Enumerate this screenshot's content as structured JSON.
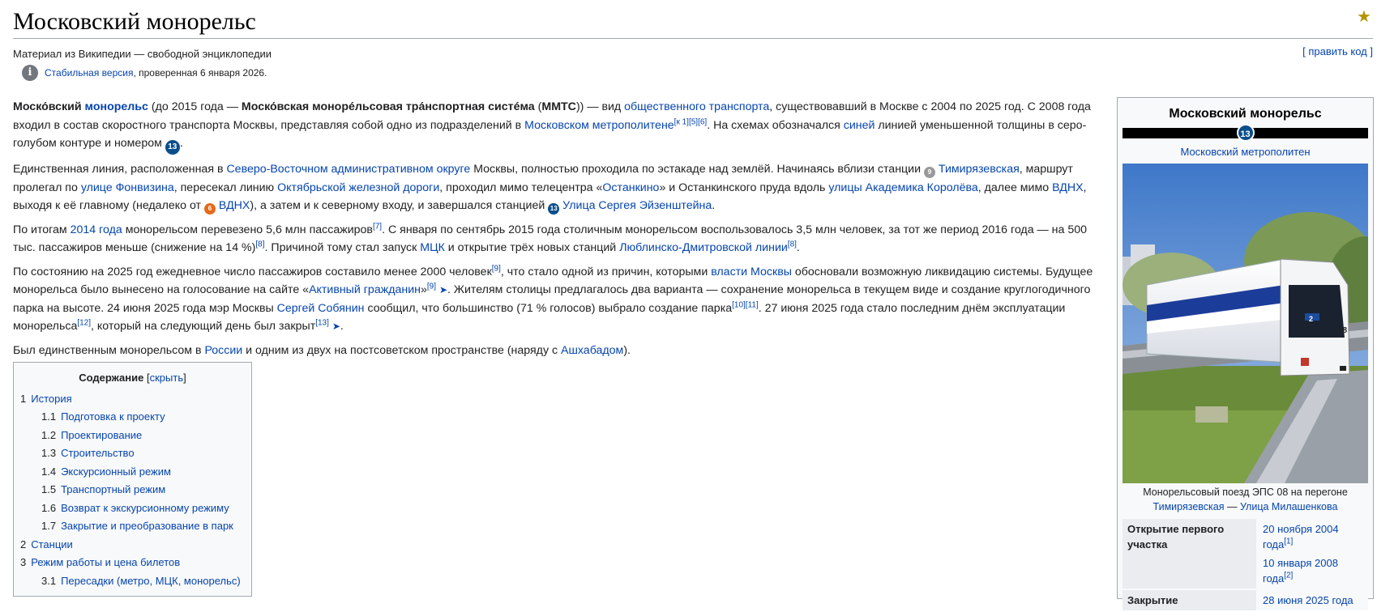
{
  "page": {
    "title": "Московский монорельс",
    "tagline": "Материал из Википедии — свободной энциклопедии",
    "edit_link": "[ править код ]",
    "stable_link": "Стабильная версия",
    "stable_rest": ", проверенная 6 января 2026."
  },
  "icons": {
    "star": "star-icon",
    "info": "info-icon",
    "line13": "line-13-badge",
    "line9": "line-9-badge",
    "line6": "line-6-badge",
    "arrow": "arrow-icon"
  },
  "colors": {
    "link": "#0645ad",
    "line13": "#0a4e8c",
    "line9": "#9a9a9a",
    "line6": "#e46b1b"
  },
  "p1": {
    "b1": "Моско́вский",
    "l1": "монорельс",
    "t1": " (до 2015 года — ",
    "b2": "Моско́вская монорéльсовая тра́нспортная систéма",
    "t2": " (",
    "b3": "ММТС",
    "t3": ")) — вид ",
    "l2": "общественного транспорта",
    "t4": ", существовавший в Москве с 2004 по 2025 год. С 2008 года входил в состав скоростного транспорта Москвы, представляя собой одно из подразделений в ",
    "l3": "Московском метрополитене",
    "s1": "[к 1]",
    "s2": "[5]",
    "s3": "[6]",
    "t5": ". На схемах обозначался ",
    "l4": "синей",
    "t6": " линией уменьшенной толщины в серо-голубом контуре и номером ",
    "badge": "13",
    "t7": "."
  },
  "p2": {
    "t1": "Единственная линия, расположенная в ",
    "l1": "Северо-Восточном административном округе",
    "t2": " Москвы, полностью проходила по эстакаде над землёй. Начинаясь вблизи станции ",
    "badge9": "9",
    "l2": "Тимирязевская",
    "t3": ", маршрут пролегал по ",
    "l3": "улице Фонвизина",
    "t4": ", пересекал линию ",
    "l4": "Октябрьской железной дороги",
    "t5": ", проходил мимо телецентра «",
    "l5": "Останкино",
    "t6": "» и Останкинского пруда вдоль ",
    "l6": "улицы Академика Королёва",
    "t7": ", далее мимо ",
    "l7": "ВДНХ",
    "t8": ", выходя к её главному (недалеко от ",
    "badge6": "6",
    "l8": "ВДНХ",
    "t9": "), а затем и к северному входу, и завершался станцией ",
    "badge13": "13",
    "l9": "Улица Сергея Эйзенштейна",
    "t10": "."
  },
  "p3": {
    "t1": "По итогам ",
    "l1": "2014 года",
    "t2": " монорельсом перевезено 5,6 млн пассажиров",
    "s1": "[7]",
    "t3": ". С января по сентябрь 2015 года столичным монорельсом воспользовалось 3,5 млн человек, за тот же период 2016 года — на 500 тыс. пассажиров меньше (снижение на 14 %)",
    "s2": "[8]",
    "t4": ". Причиной тому стал запуск ",
    "l2": "МЦК",
    "t5": " и открытие трёх новых станций ",
    "l3": "Люблинско-Дмитровской линии",
    "s3": "[8]",
    "t6": "."
  },
  "p4": {
    "t1": "По состоянию на 2025 год ежедневное число пассажиров составило менее 2000 человек",
    "s1": "[9]",
    "t2": ", что стало одной из причин, которыми ",
    "l1": "власти Москвы",
    "t3": " обосновали возможную ликвидацию системы. Будущее монорельса было вынесено на голосование на сайте «",
    "l2": "Активный гражданин",
    "t4": "»",
    "s2": "[9]",
    "t5": ". Жителям столицы предлагалось два варианта — сохранение монорельса в текущем виде и создание круглогодичного парка на высоте. 24 июня 2025 года мэр Москвы ",
    "l3": "Сергей Собянин",
    "t6": " сообщил, что большинство (71 % голосов) выбрало создание парка",
    "s3": "[10]",
    "s4": "[11]",
    "t7": ". 27 июня 2025 года стало последним днём эксплуатации монорельса",
    "s5": "[12]",
    "t8": ", который на следующий день был закрыт",
    "s6": "[13]",
    "t9": "."
  },
  "p5": {
    "t1": "Был единственным монорельсом в ",
    "l1": "России",
    "t2": " и одним из двух на постсоветском пространстве (наряду с ",
    "l2": "Ашхабадом",
    "t3": ")."
  },
  "toc": {
    "title": "Содержание",
    "toggle_open": "[",
    "toggle": "скрыть",
    "toggle_close": "]",
    "items": [
      {
        "num": "1",
        "label": "История",
        "level": 1
      },
      {
        "num": "1.1",
        "label": "Подготовка к проекту",
        "level": 2
      },
      {
        "num": "1.2",
        "label": "Проектирование",
        "level": 2
      },
      {
        "num": "1.3",
        "label": "Строительство",
        "level": 2
      },
      {
        "num": "1.4",
        "label": "Экскурсионный режим",
        "level": 2
      },
      {
        "num": "1.5",
        "label": "Транспортный режим",
        "level": 2
      },
      {
        "num": "1.6",
        "label": "Возврат к экскурсионному режиму",
        "level": 2
      },
      {
        "num": "1.7",
        "label": "Закрытие и преобразование в парк",
        "level": 2
      },
      {
        "num": "2",
        "label": "Станции",
        "level": 1
      },
      {
        "num": "3",
        "label": "Режим работы и цена билетов",
        "level": 1
      },
      {
        "num": "3.1",
        "label": "Пересадки (метро, МЦК, монорельс)",
        "level": 2
      }
    ]
  },
  "infobox": {
    "title": "Московский монорельс",
    "badge": "13",
    "subtitle": "Московский метрополитен",
    "train_number": "08",
    "train_badge": "2",
    "caption": "Монорельсовый поезд ЭПС 08 на перегоне",
    "caption_l1": "Тимирязевская",
    "caption_sep": " — ",
    "caption_l2": "Улица Милашенкова",
    "row1_label": "Открытие первого участка",
    "row1_v1": "20 ноября 2004 года",
    "row1_s1": "[1]",
    "row1_v2": "10 января 2008 года",
    "row1_s2": "[2]",
    "row2_label": "Закрытие",
    "row2_v1": "28 июня 2025 года"
  }
}
